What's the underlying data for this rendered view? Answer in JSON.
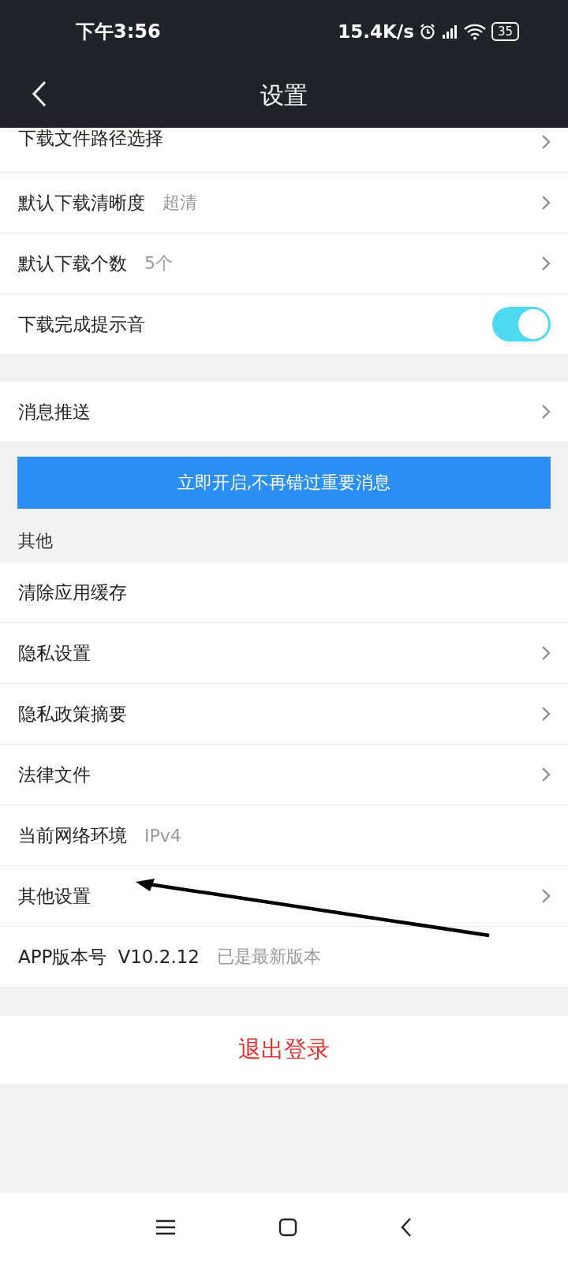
{
  "status_bar": {
    "time": "下午3:56",
    "speed": "15.4K/s",
    "battery": "35"
  },
  "header": {
    "title": "设置"
  },
  "download_group": [
    {
      "kind": "link",
      "label": "下载文件路径选择"
    },
    {
      "kind": "link",
      "label": "默认下载清晰度",
      "value": "超清"
    },
    {
      "kind": "link",
      "label": "默认下载个数",
      "value": "5个"
    },
    {
      "kind": "toggle",
      "label": "下载完成提示音",
      "on": true
    }
  ],
  "push_group": [
    {
      "kind": "link",
      "label": "消息推送"
    }
  ],
  "push_banner": "立即开启,不再错过重要消息",
  "other_section": {
    "title": "其他",
    "items": [
      {
        "kind": "info",
        "label": "清除应用缓存"
      },
      {
        "kind": "link",
        "label": "隐私设置"
      },
      {
        "kind": "link",
        "label": "隐私政策摘要"
      },
      {
        "kind": "link",
        "label": "法律文件"
      },
      {
        "kind": "info",
        "label": "当前网络环境",
        "value": "IPv4"
      },
      {
        "kind": "link",
        "label": "其他设置"
      },
      {
        "kind": "version",
        "label": "APP版本号",
        "version": "V10.2.12",
        "value": "已是最新版本"
      }
    ]
  },
  "logout_button": "退出登录"
}
